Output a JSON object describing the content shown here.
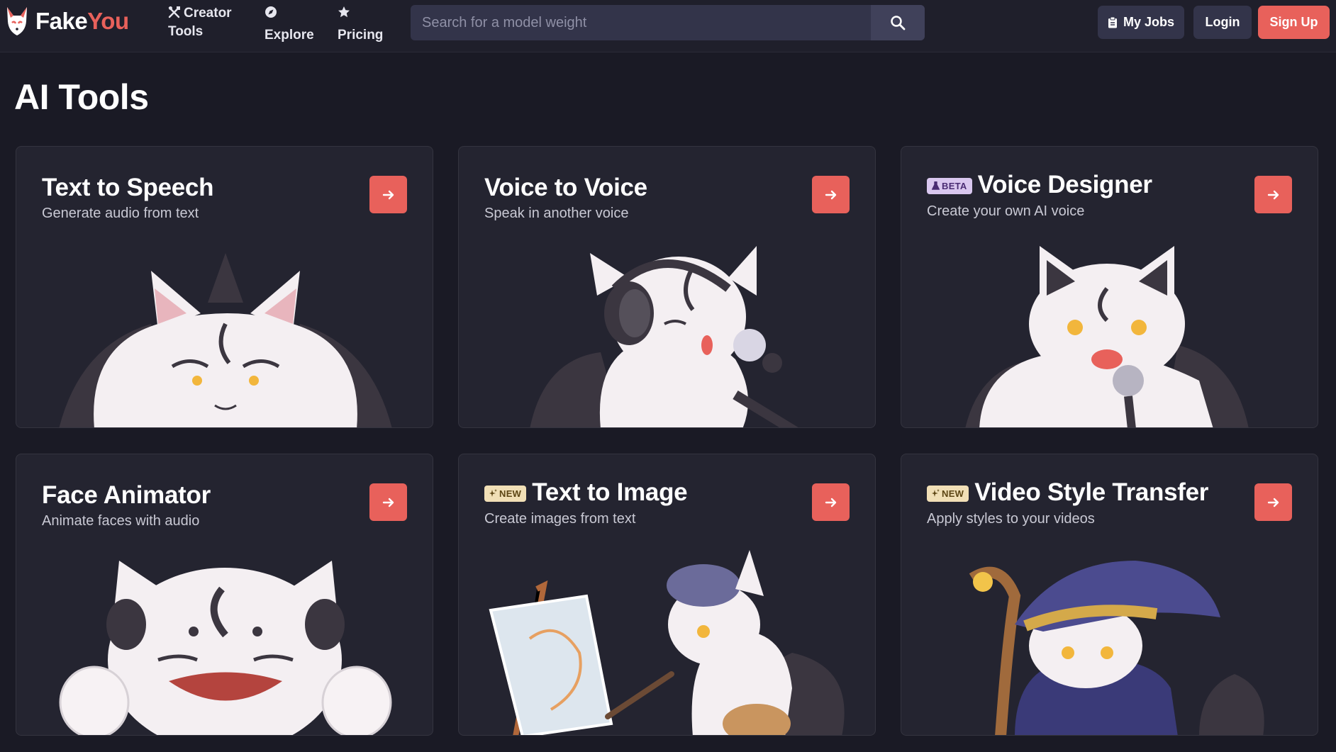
{
  "brand": {
    "name_part1": "Fake",
    "name_part2": "You"
  },
  "nav": {
    "creator_tools": {
      "line1": "Creator",
      "line2": "Tools"
    },
    "explore": "Explore",
    "pricing": "Pricing"
  },
  "search": {
    "placeholder": "Search for a model weight",
    "value": ""
  },
  "header_buttons": {
    "my_jobs": "My Jobs",
    "login": "Login",
    "signup": "Sign Up"
  },
  "page": {
    "title": "AI Tools"
  },
  "cards": [
    {
      "title": "Text to Speech",
      "subtitle": "Generate audio from text",
      "badge": ""
    },
    {
      "title": "Voice to Voice",
      "subtitle": "Speak in another voice",
      "badge": ""
    },
    {
      "title": "Voice Designer",
      "subtitle": "Create your own AI voice",
      "badge": "BETA"
    },
    {
      "title": "Face Animator",
      "subtitle": "Animate faces with audio",
      "badge": ""
    },
    {
      "title": "Text to Image",
      "subtitle": "Create images from text",
      "badge": "NEW"
    },
    {
      "title": "Video Style Transfer",
      "subtitle": "Apply styles to your videos",
      "badge": "NEW"
    }
  ],
  "colors": {
    "background": "#1a1a25",
    "nav_background": "#1f1f2b",
    "card_background": "#242430",
    "accent": "#e8615b",
    "button_secondary": "#33344a",
    "badge_beta": "#d9c7ef",
    "badge_new": "#f1dfb6"
  },
  "icons": {
    "logo": "fox-mask-logo",
    "creator_tools": "tools-icon",
    "explore": "compass-icon",
    "pricing": "star-icon",
    "search": "search-icon",
    "my_jobs": "clipboard-icon",
    "card_action": "arrow-right-icon",
    "beta": "flask-icon",
    "new": "sparkle-icon"
  }
}
